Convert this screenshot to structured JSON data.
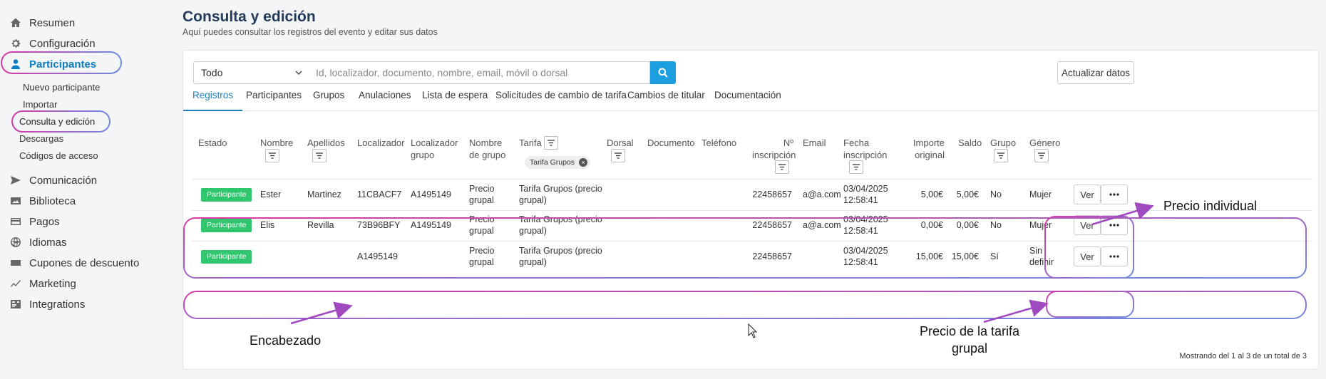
{
  "sidebar": {
    "items": [
      {
        "label": "Resumen",
        "icon": "home-icon"
      },
      {
        "label": "Configuración",
        "icon": "gear-icon"
      },
      {
        "label": "Participantes",
        "icon": "user-icon",
        "active": true
      },
      {
        "label": "Comunicación",
        "icon": "send-icon"
      },
      {
        "label": "Biblioteca",
        "icon": "image-icon"
      },
      {
        "label": "Pagos",
        "icon": "card-icon"
      },
      {
        "label": "Idiomas",
        "icon": "globe-icon"
      },
      {
        "label": "Cupones de descuento",
        "icon": "ticket-icon"
      },
      {
        "label": "Marketing",
        "icon": "chart-line-icon"
      },
      {
        "label": "Integrations",
        "icon": "integrations-icon"
      }
    ],
    "subitems": [
      {
        "label": "Nuevo participante"
      },
      {
        "label": "Importar"
      },
      {
        "label": "Consulta y edición",
        "current": true
      },
      {
        "label": "Descargas"
      },
      {
        "label": "Códigos de acceso"
      }
    ]
  },
  "header": {
    "title": "Consulta y edición",
    "subtitle": "Aquí puedes consultar los registros del evento y editar sus datos"
  },
  "toolbar": {
    "filter_value": "Todo",
    "search_placeholder": "Id, localizador, documento, nombre, email, móvil o dorsal",
    "refresh_label": "Actualizar datos"
  },
  "tabs": [
    {
      "label": "Registros",
      "active": true
    },
    {
      "label": "Participantes"
    },
    {
      "label": "Grupos"
    },
    {
      "label": "Anulaciones"
    },
    {
      "label": "Lista de espera"
    },
    {
      "label": "Solicitudes de cambio de tarifa"
    },
    {
      "label": "Cambios de titular"
    },
    {
      "label": "Documentación"
    }
  ],
  "table": {
    "columns": [
      {
        "label": "Estado"
      },
      {
        "label": "Nombre"
      },
      {
        "label": "Apellidos"
      },
      {
        "label": "Localizador"
      },
      {
        "label": "Localizador grupo"
      },
      {
        "label": "Nombre de grupo"
      },
      {
        "label": "Tarifa"
      },
      {
        "label": "Dorsal"
      },
      {
        "label": "Documento"
      },
      {
        "label": "Teléfono"
      },
      {
        "label": "Nº inscripción"
      },
      {
        "label": "Email"
      },
      {
        "label": "Fecha inscripción"
      },
      {
        "label": "Importe original"
      },
      {
        "label": "Saldo"
      },
      {
        "label": "Grupo"
      },
      {
        "label": "Género"
      }
    ],
    "tarifa_filter_chip": "Tarifa Grupos",
    "rows": [
      {
        "estado": "Participante",
        "nombre": "Ester",
        "apellidos": "Martinez",
        "localizador": "11CBACF7",
        "localizador_grupo": "A1495149",
        "nombre_grupo": "Precio grupal",
        "tarifa": "Tarifa Grupos (precio grupal)",
        "n_inscripcion": "22458657",
        "email": "a@a.com",
        "fecha": "03/04/2025 12:58:41",
        "importe": "5,00€",
        "saldo": "5,00€",
        "grupo": "No",
        "genero": "Mujer"
      },
      {
        "estado": "Participante",
        "nombre": "Elis",
        "apellidos": "Revilla",
        "localizador": "73B96BFY",
        "localizador_grupo": "A1495149",
        "nombre_grupo": "Precio grupal",
        "tarifa": "Tarifa Grupos (precio grupal)",
        "n_inscripcion": "22458657",
        "email": "a@a.com",
        "fecha": "03/04/2025 12:58:41",
        "importe": "0,00€",
        "saldo": "0,00€",
        "grupo": "No",
        "genero": "Mujer"
      },
      {
        "estado": "Participante",
        "nombre": "",
        "apellidos": "",
        "localizador": "A1495149",
        "localizador_grupo": "",
        "nombre_grupo": "Precio grupal",
        "tarifa": "Tarifa Grupos (precio grupal)",
        "n_inscripcion": "22458657",
        "email": "",
        "fecha": "03/04/2025 12:58:41",
        "importe": "15,00€",
        "saldo": "15,00€",
        "grupo": "Sí",
        "genero": "Sin definir"
      }
    ],
    "ver_label": "Ver",
    "footer": "Mostrando del 1 al 3 de un total de 3"
  },
  "annotations": {
    "precio_individual": "Precio individual",
    "encabezado": "Encabezado",
    "precio_tarifa_grupal": "Precio de la tarifa grupal",
    "ring_colors": [
      "#d63aa8",
      "#6f8be0"
    ]
  }
}
